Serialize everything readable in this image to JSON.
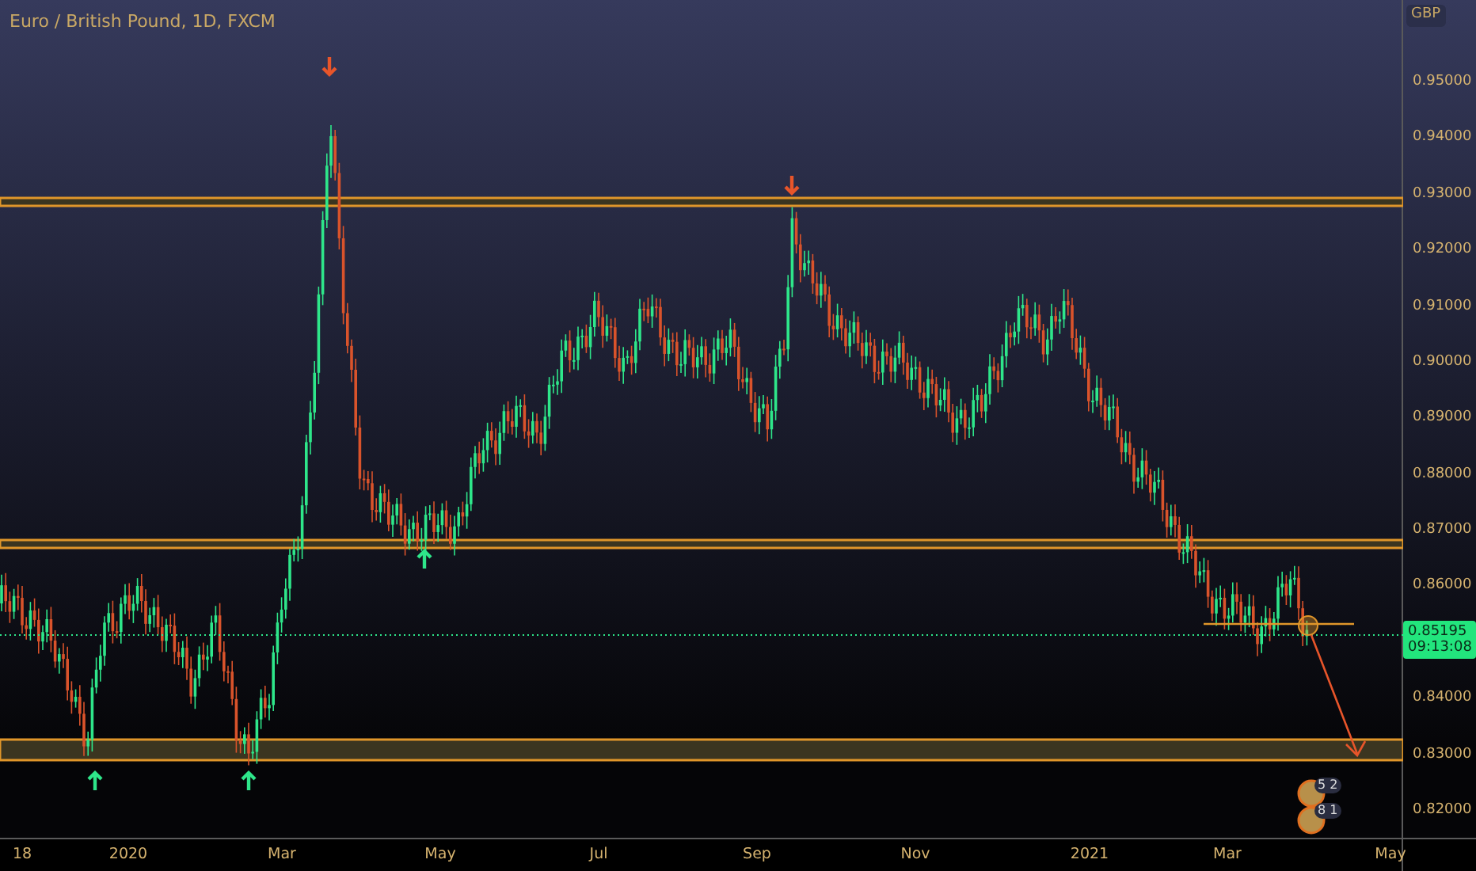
{
  "chart": {
    "title": "Euro / British Pound, 1D, FXCM",
    "currency": "GBP",
    "price_ticks": [
      "0.95000",
      "0.94000",
      "0.93000",
      "0.92000",
      "0.91000",
      "0.90000",
      "0.89000",
      "0.88000",
      "0.87000",
      "0.86000",
      "0.84000",
      "0.83000",
      "0.82000"
    ],
    "time_ticks": [
      "18",
      "2020",
      "Mar",
      "May",
      "Jul",
      "Sep",
      "Nov",
      "2021",
      "Mar",
      "May"
    ],
    "last_price": {
      "value": "0.85195",
      "countdown": "09:13:08"
    },
    "logo": {
      "badges": [
        "5 2",
        "8 1"
      ]
    }
  }
}
